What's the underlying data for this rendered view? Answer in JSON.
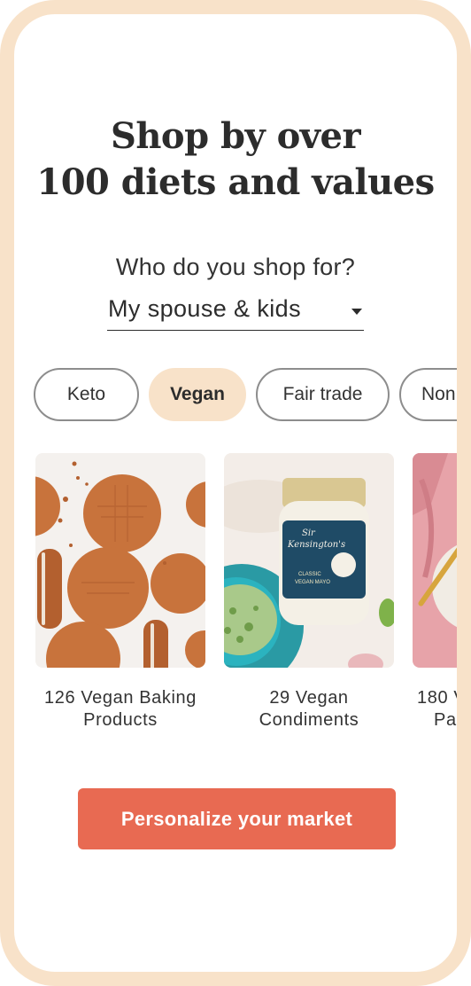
{
  "header": {
    "title_line1": "Shop by over",
    "title_line2": "100 diets and values"
  },
  "shopper": {
    "question": "Who do you shop for?",
    "selected": "My spouse & kids"
  },
  "diet_chips": [
    {
      "label": "Keto",
      "active": false
    },
    {
      "label": "Vegan",
      "active": true
    },
    {
      "label": "Fair trade",
      "active": false
    },
    {
      "label": "Non",
      "active": false
    }
  ],
  "categories": [
    {
      "line1": "126 Vegan Baking",
      "line2": "Products",
      "image": "cookies"
    },
    {
      "line1": "29 Vegan",
      "line2": "Condiments",
      "image": "vegan-mayo-jar"
    },
    {
      "line1": "180 V",
      "line2": "Pa",
      "image": "pasta-dish"
    }
  ],
  "product_label": {
    "brand_line1": "Sir",
    "brand_line2": "Kensington's",
    "sub1": "CLASSIC",
    "sub2": "VEGAN MAYO"
  },
  "cta": {
    "label": "Personalize your market"
  },
  "colors": {
    "frame": "#f8e2c9",
    "active_chip": "#f8e2c9",
    "cta": "#e86a52",
    "text": "#2c2c2c"
  }
}
